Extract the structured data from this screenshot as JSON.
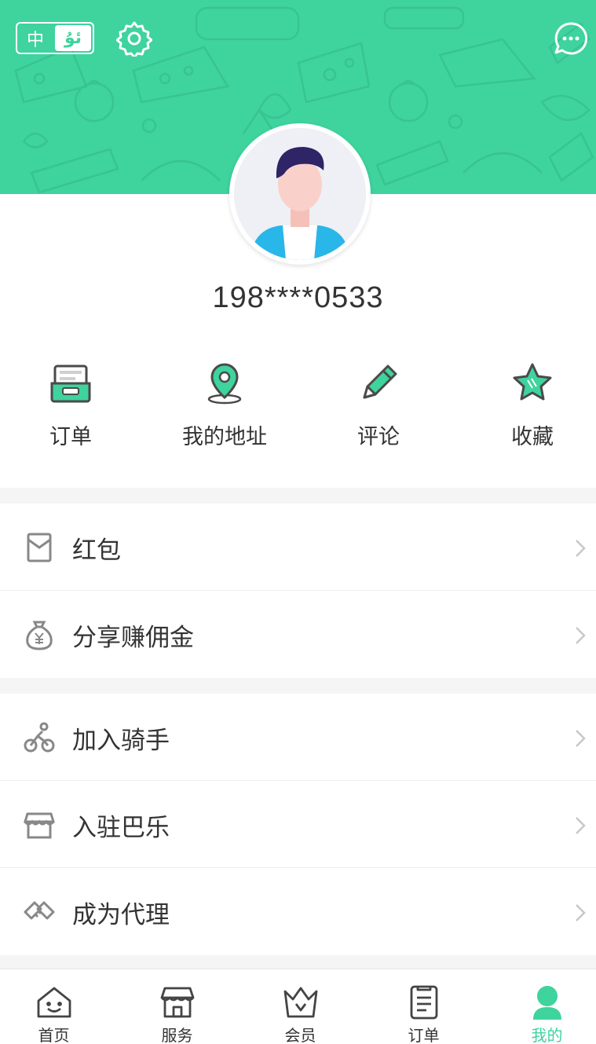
{
  "header": {
    "lang_toggle": {
      "zh_label": "中",
      "ug_label": "ئۇ",
      "active": "ug"
    },
    "settings_icon": "gear-icon",
    "message_icon": "chat-bubble-icon"
  },
  "profile": {
    "avatar_icon": "user-avatar",
    "phone": "198****0533"
  },
  "quick_actions": [
    {
      "label": "订单",
      "icon": "order-box-icon"
    },
    {
      "label": "我的地址",
      "icon": "location-pin-icon"
    },
    {
      "label": "评论",
      "icon": "pencil-icon"
    },
    {
      "label": "收藏",
      "icon": "star-icon"
    }
  ],
  "menu_groups": [
    [
      {
        "label": "红包",
        "icon": "red-envelope-icon"
      },
      {
        "label": "分享赚佣金",
        "icon": "money-bag-icon"
      }
    ],
    [
      {
        "label": "加入骑手",
        "icon": "bicycle-rider-icon"
      },
      {
        "label": "入驻巴乐",
        "icon": "store-icon"
      },
      {
        "label": "成为代理",
        "icon": "handshake-icon"
      }
    ]
  ],
  "tabbar": {
    "items": [
      {
        "label": "首页",
        "icon": "home-icon"
      },
      {
        "label": "服务",
        "icon": "shop-icon"
      },
      {
        "label": "会员",
        "icon": "crown-icon"
      },
      {
        "label": "订单",
        "icon": "clipboard-icon"
      },
      {
        "label": "我的",
        "icon": "person-icon"
      }
    ],
    "active_index": 4
  },
  "colors": {
    "brand_green": "#3fd39e",
    "text": "#333333",
    "icon_gray": "#888888",
    "divider": "#eeeeee"
  }
}
